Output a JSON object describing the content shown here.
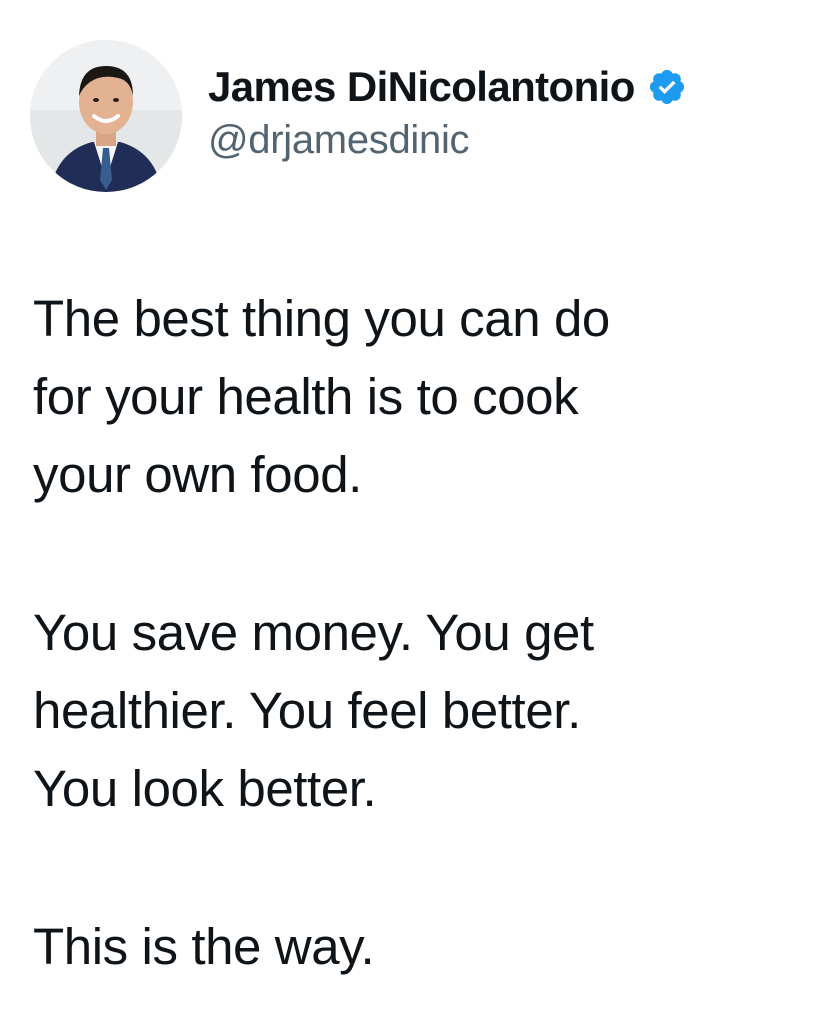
{
  "author": {
    "display_name": "James DiNicolantonio",
    "handle": "@drjamesdinic",
    "verified": true,
    "verified_icon": "verified-badge-icon",
    "avatar": "profile-photo-avatar"
  },
  "tweet": {
    "paragraphs": [
      {
        "lines": [
          "The best thing you can do",
          "for your health is to cook",
          "your own food."
        ]
      },
      {
        "lines": [
          "You save money. You get",
          "healthier. You feel better.",
          "You look better."
        ]
      },
      {
        "lines": [
          "This is the way."
        ]
      }
    ]
  },
  "colors": {
    "text": "#0f1419",
    "handle": "#536471",
    "verified_blue": "#1d9bf0",
    "background": "#ffffff"
  }
}
